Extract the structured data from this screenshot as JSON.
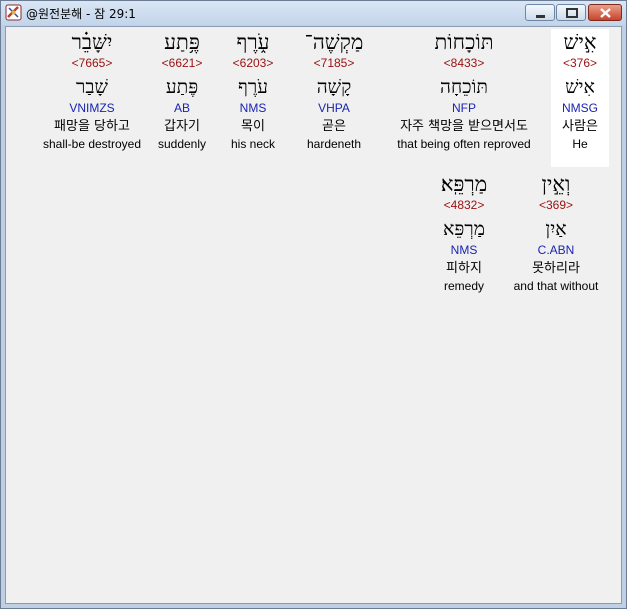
{
  "window": {
    "title": "@원전분해 - 잠 29:1",
    "icon": "bible-app-icon",
    "minimize_icon": "minimize-icon",
    "maximize_icon": "maximize-icon",
    "close_icon": "close-icon"
  },
  "colors": {
    "strong": "#9a1010",
    "morph": "#1a24b0",
    "highlight": "#ffffff",
    "background": "#f0f0f0"
  },
  "words": [
    {
      "heb": "אִ֣ישׁ",
      "strong": "<376>",
      "lemma": "אִישׁ",
      "morph": "NMSG",
      "kor": "사람은",
      "eng": "He",
      "selected": true
    },
    {
      "heb": "תּוֹכָחוֹת",
      "strong": "<8433>",
      "lemma": "תּוֹכֵחָה",
      "morph": "NFP",
      "kor": "자주 책망을 받으면서도",
      "eng": "that being often reproved",
      "selected": false
    },
    {
      "heb": "מַקְשֶׁה־",
      "strong": "<7185>",
      "lemma": "קָשָׁה",
      "morph": "VHPA",
      "kor": "곧은",
      "eng": "hardeneth",
      "selected": false
    },
    {
      "heb": "עֹ֑רֶף",
      "strong": "<6203>",
      "lemma": "עֹרֶף",
      "morph": "NMS",
      "kor": "목이",
      "eng": "his neck",
      "selected": false
    },
    {
      "heb": "פֶּ֥תַע",
      "strong": "<6621>",
      "lemma": "פֶּתַע",
      "morph": "AB",
      "kor": "갑자기",
      "eng": "suddenly",
      "selected": false
    },
    {
      "heb": "יִשָּׁבֵ֗ר",
      "strong": "<7665>",
      "lemma": "שָׁבַר",
      "morph": "VNIMZS",
      "kor": "패망을 당하고",
      "eng": "shall-be destroyed",
      "selected": false
    },
    {
      "heb": "וְאֵ֣ין",
      "strong": "<369>",
      "lemma": "אַיִן",
      "morph": "C.ABN",
      "kor": "못하리라",
      "eng": "and that without",
      "selected": false
    },
    {
      "heb": "מַרְפֵּֽא׃",
      "strong": "<4832>",
      "lemma": "מַרְפֵּא",
      "morph": "NMS",
      "kor": "피하지",
      "eng": "remedy",
      "selected": false
    }
  ]
}
